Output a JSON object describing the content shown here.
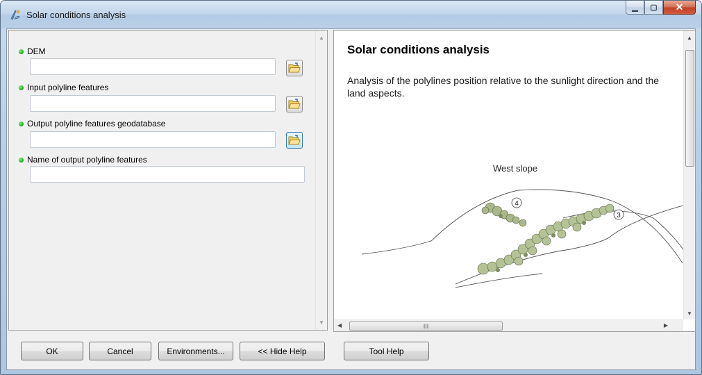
{
  "window": {
    "title": "Solar conditions analysis",
    "minimize_glyph": "▁",
    "maximize_glyph": "▢",
    "close_glyph": "✕"
  },
  "params": [
    {
      "label": "DEM",
      "value": "",
      "has_browse": true
    },
    {
      "label": "Input polyline features",
      "value": "",
      "has_browse": true
    },
    {
      "label": "Output polyline features geodatabase",
      "value": "",
      "has_browse": true
    },
    {
      "label": "Name of output polyline features",
      "value": "",
      "has_browse": false
    }
  ],
  "help": {
    "title": "Solar conditions analysis",
    "description": "Analysis of the polylines position relative to the sunlight direction and the land aspects.",
    "illustration": {
      "caption": "West slope",
      "marker_4": "4",
      "marker_3": "3"
    },
    "hscroll_grip": "III"
  },
  "buttons": {
    "ok": "OK",
    "cancel": "Cancel",
    "environments": "Environments...",
    "hide_help": "<< Hide Help",
    "tool_help": "Tool Help"
  },
  "icons": {
    "app": "toolbox-icon",
    "browse": "open-folder-icon",
    "status_dot": "green-dot-icon"
  },
  "colors": {
    "status_dot": "#16a816",
    "titlebar": "#c3d6ec",
    "close_button": "#c2432a"
  }
}
